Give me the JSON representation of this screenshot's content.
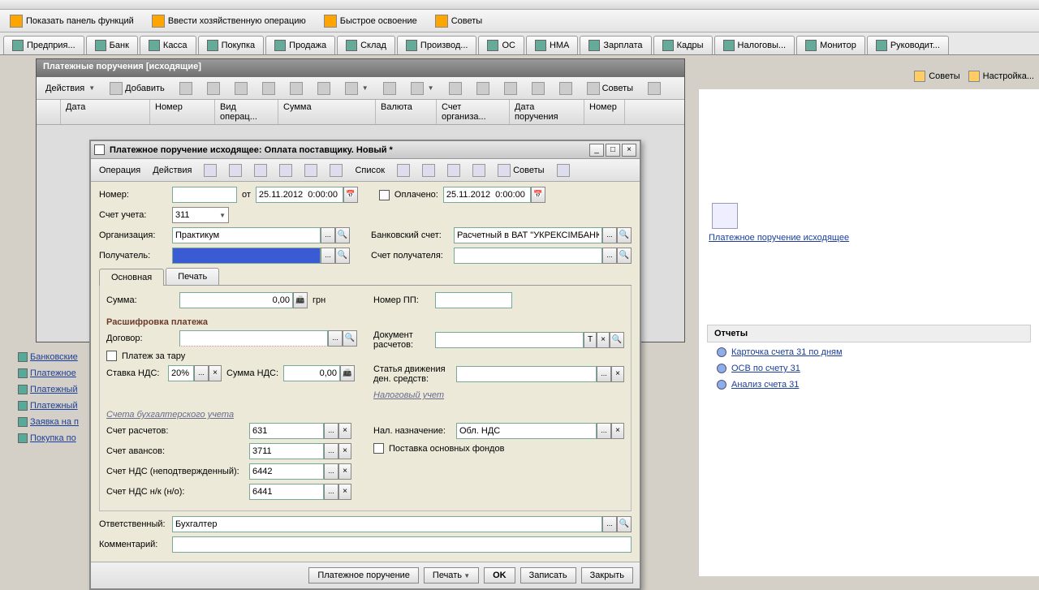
{
  "toolbar2": {
    "show_panel": "Показать панель функций",
    "enter_op": "Ввести хозяйственную операцию",
    "quick_start": "Быстрое освоение",
    "tips": "Советы"
  },
  "tabs": [
    "Предприя...",
    "Банк",
    "Касса",
    "Покупка",
    "Продажа",
    "Склад",
    "Производ...",
    "ОС",
    "НМА",
    "Зарплата",
    "Кадры",
    "Налоговы...",
    "Монитор",
    "Руководит..."
  ],
  "right_top": {
    "tips": "Советы",
    "settings": "Настройка..."
  },
  "list": {
    "title": "Платежные поручения [исходящие]",
    "actions": "Действия",
    "add": "Добавить",
    "tips": "Советы",
    "cols": [
      "",
      "Дата",
      "Номер",
      "Вид операц...",
      "Сумма",
      "Валюта",
      "Счет организа...",
      "Дата поручения",
      "Номер"
    ]
  },
  "left_tree": [
    "Банковские",
    "Платежное",
    "Платежный",
    "Платежный",
    "Заявка на п",
    "Покупка по"
  ],
  "right_side": {
    "doc_link": "Платежное поручение исходящее",
    "reports_hdr": "Отчеты",
    "reports": [
      "Карточка счета 31 по дням",
      "ОСВ по счету 31",
      "Анализ счета 31"
    ]
  },
  "dialog": {
    "title": "Платежное поручение исходящее: Оплата поставщику. Новый *",
    "operation": "Операция",
    "actions": "Действия",
    "list_btn": "Список",
    "tips": "Советы",
    "number_lbl": "Номер:",
    "from": "от",
    "date1": "25.11.2012  0:00:00",
    "paid": "Оплачено:",
    "date2": "25.11.2012  0:00:00",
    "account_lbl": "Счет учета:",
    "account_val": "311",
    "org_lbl": "Организация:",
    "org_val": "Практикум",
    "bank_acc_lbl": "Банковский счет:",
    "bank_acc_val": "Расчетный в ВАТ \"УКРЕКСІМБАНК\"",
    "recipient_lbl": "Получатель:",
    "recipient_acc_lbl": "Счет получателя:",
    "tab_main": "Основная",
    "tab_print": "Печать",
    "sum_lbl": "Сумма:",
    "sum_val": "0,00",
    "currency": "грн",
    "pp_num_lbl": "Номер ПП:",
    "decode_hdr": "Расшифровка платежа",
    "contract_lbl": "Договор:",
    "doc_calc_lbl": "Документ расчетов:",
    "tare_lbl": "Платеж за тару",
    "vat_rate_lbl": "Ставка НДС:",
    "vat_rate_val": "20%",
    "vat_sum_lbl": "Сумма НДС:",
    "vat_sum_val": "0,00",
    "cash_flow_lbl": "Статья движения ден. средств:",
    "tax_acc_hdr": "Налоговый учет",
    "acc_hdr": "Счета бухгалтерского учета",
    "acc_calc_lbl": "Счет расчетов:",
    "acc_calc_val": "631",
    "acc_adv_lbl": "Счет авансов:",
    "acc_adv_val": "3711",
    "acc_vat_unconf_lbl": "Счет НДС (неподтвержденный):",
    "acc_vat_unconf_val": "6442",
    "acc_vat_nk_lbl": "Счет НДС н/к (н/о):",
    "acc_vat_nk_val": "6441",
    "tax_purpose_lbl": "Нал. назначение:",
    "tax_purpose_val": "Обл. НДС",
    "fixed_assets_lbl": "Поставка основных фондов",
    "responsible_lbl": "Ответственный:",
    "responsible_val": "Бухгалтер",
    "comment_lbl": "Комментарий:",
    "btn_payment": "Платежное поручение",
    "btn_print": "Печать",
    "btn_ok": "OK",
    "btn_save": "Записать",
    "btn_close": "Закрыть"
  }
}
